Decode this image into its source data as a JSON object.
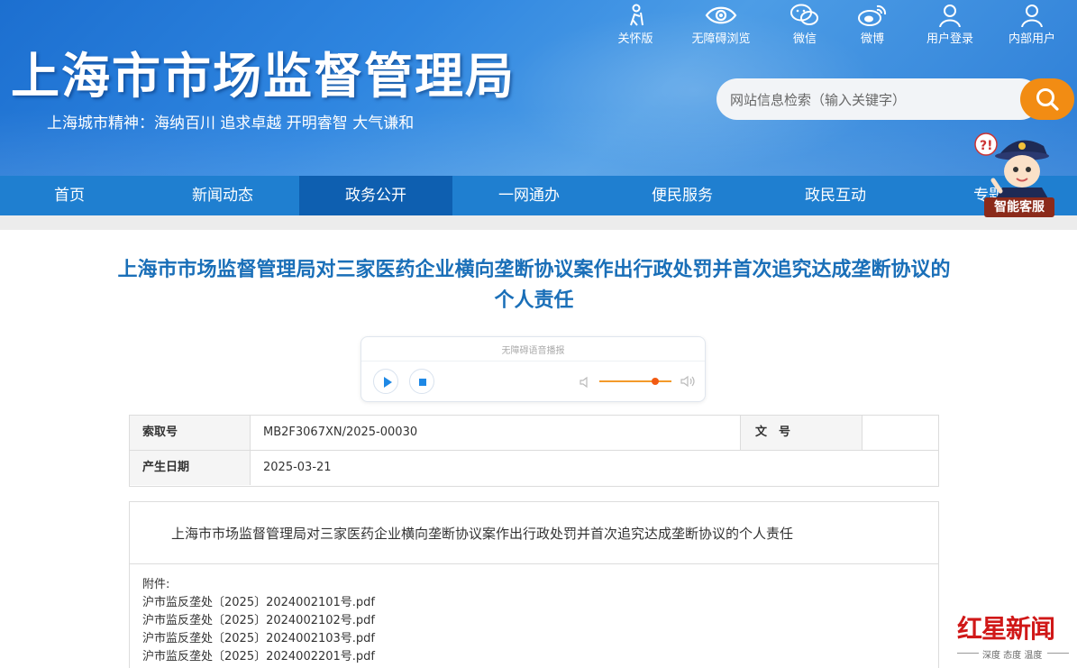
{
  "header": {
    "site_title": "上海市市场监督管理局",
    "spirit": "上海城市精神：海纳百川    追求卓越    开明睿智    大气谦和",
    "top_links": [
      {
        "label": "关怀版",
        "icon": "elder-care-icon"
      },
      {
        "label": "无障碍浏览",
        "icon": "eye-icon"
      },
      {
        "label": "微信",
        "icon": "wechat-icon"
      },
      {
        "label": "微博",
        "icon": "weibo-icon"
      },
      {
        "label": "用户登录",
        "icon": "user-icon"
      },
      {
        "label": "内部用户",
        "icon": "user-icon"
      }
    ],
    "search": {
      "placeholder": "网站信息检索（输入关键字）",
      "icon": "search-icon"
    }
  },
  "nav": {
    "items": [
      "首页",
      "新闻动态",
      "政务公开",
      "一网通办",
      "便民服务",
      "政民互动",
      "专题"
    ],
    "active": "政务公开"
  },
  "assistant": {
    "label": "智能客服"
  },
  "article": {
    "title": "上海市市场监督管理局对三家医药企业横向垄断协议案作出行政处罚并首次追究达成垄断协议的个人责任",
    "player": {
      "label": "无障碍语音播报"
    },
    "meta": {
      "index_key": "索取号",
      "index_value": "MB2F3067XN/2025-00030",
      "doc_key": "文　号",
      "doc_value": "",
      "date_key": "产生日期",
      "date_value": "2025-03-21"
    },
    "summary": "上海市市场监督管理局对三家医药企业横向垄断协议案作出行政处罚并首次追究达成垄断协议的个人责任",
    "attachments_header": "附件:",
    "attachments": [
      "沪市监反垄处〔2025〕2024002101号.pdf",
      "沪市监反垄处〔2025〕2024002102号.pdf",
      "沪市监反垄处〔2025〕2024002103号.pdf",
      "沪市监反垄处〔2025〕2024002201号.pdf"
    ]
  },
  "watermark": {
    "main": "红星新闻",
    "sub": "深度 态度 温度"
  },
  "colors": {
    "header_blue": "#2f86e0",
    "nav_blue": "#1f7fd0",
    "nav_active": "#0e5fb0",
    "title_blue": "#1a6fb8",
    "search_orange": "#f28c13"
  }
}
